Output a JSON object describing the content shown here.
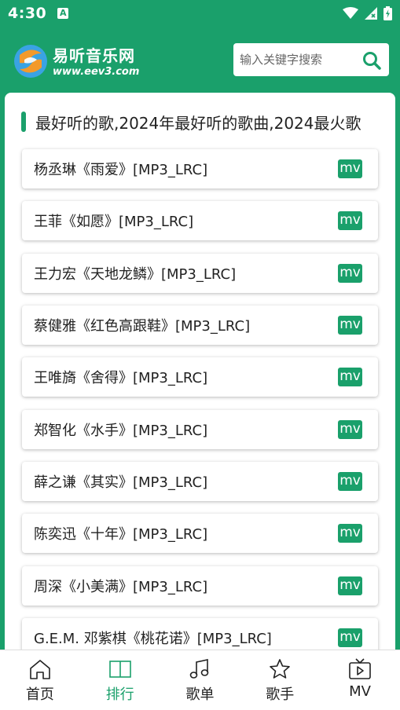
{
  "status_bar": {
    "time": "4:30",
    "notification_letter": "A"
  },
  "header": {
    "logo_name": "易听音乐网",
    "logo_url": "www.eev3.com",
    "search_placeholder": "输入关键字搜索"
  },
  "section": {
    "title": "最好听的歌,2024年最好听的歌曲,2024最火歌"
  },
  "songs": [
    {
      "title": "杨丞琳《雨爱》[MP3_LRC]",
      "badge": "mv"
    },
    {
      "title": "王菲《如愿》[MP3_LRC]",
      "badge": "mv"
    },
    {
      "title": "王力宏《天地龙鳞》[MP3_LRC]",
      "badge": "mv"
    },
    {
      "title": "蔡健雅《红色高跟鞋》[MP3_LRC]",
      "badge": "mv"
    },
    {
      "title": "王唯旖《舍得》[MP3_LRC]",
      "badge": "mv"
    },
    {
      "title": "郑智化《水手》[MP3_LRC]",
      "badge": "mv"
    },
    {
      "title": "薛之谦《其实》[MP3_LRC]",
      "badge": "mv"
    },
    {
      "title": "陈奕迅《十年》[MP3_LRC]",
      "badge": "mv"
    },
    {
      "title": "周深《小美满》[MP3_LRC]",
      "badge": "mv"
    },
    {
      "title": "G.E.M. 邓紫棋《桃花诺》[MP3_LRC]",
      "badge": "mv"
    }
  ],
  "bottom_nav": {
    "home": "首页",
    "rank": "排行",
    "playlist": "歌单",
    "singer": "歌手",
    "mv": "MV"
  },
  "colors": {
    "accent": "#1aa06b",
    "logo_orange": "#f39a2b",
    "logo_blue": "#3aa3e3"
  }
}
